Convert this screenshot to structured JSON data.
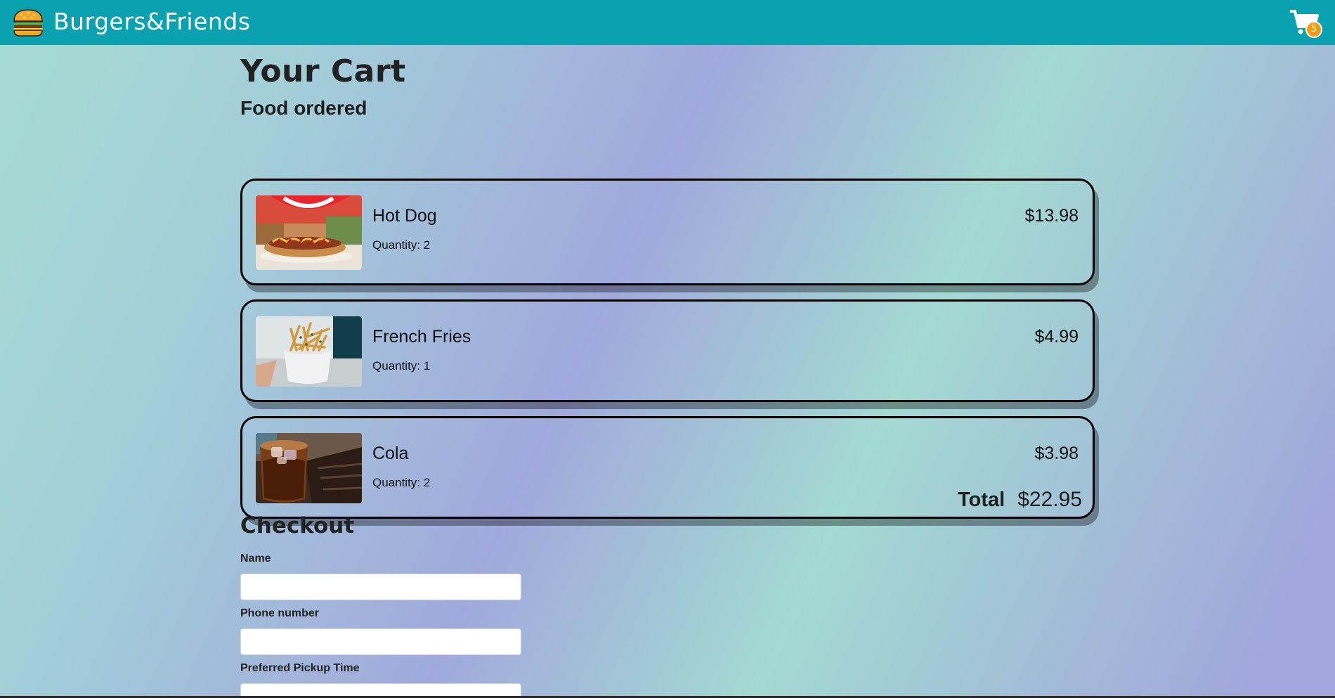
{
  "header": {
    "brand": "Burgers&Friends",
    "logo_icon": "burger-icon",
    "cart_icon": "shopping-cart-icon",
    "cart_count": "5",
    "bar_color": "#0aa1b0",
    "badge_color": "#f39c12"
  },
  "page": {
    "title": "Your Cart",
    "section": "Food ordered"
  },
  "cart": {
    "items": [
      {
        "name": "Hot Dog",
        "quantity": "Quantity: 2",
        "price": "$13.98",
        "image": "hot-dog-photo"
      },
      {
        "name": "French Fries",
        "quantity": "Quantity: 1",
        "price": "$4.99",
        "image": "french-fries-photo"
      },
      {
        "name": "Cola",
        "quantity": "Quantity: 2",
        "price": "$3.98",
        "image": "cola-photo"
      }
    ],
    "total_label": "Total",
    "total_value": "$22.95"
  },
  "checkout": {
    "title": "Checkout",
    "name_label": "Name",
    "name_value": "",
    "phone_label": "Phone number",
    "phone_value": "",
    "pickup_label": "Preferred Pickup Time",
    "pickup_value": ""
  }
}
